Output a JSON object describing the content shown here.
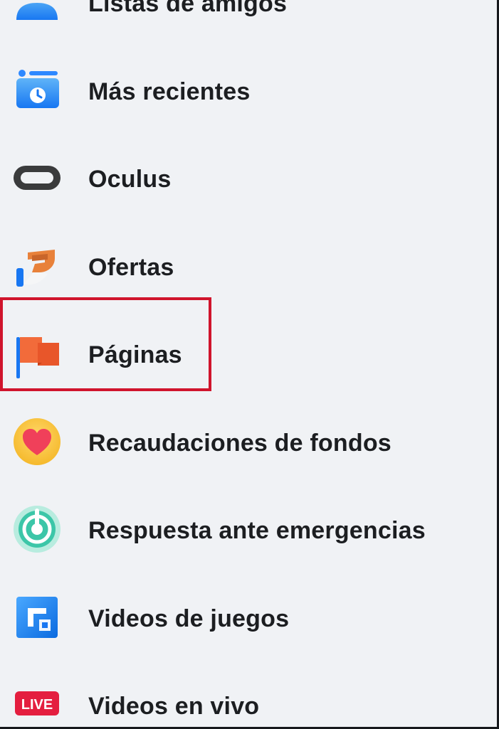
{
  "menu": {
    "items": [
      {
        "label": "Listas de amigos",
        "icon": "friend-lists-icon"
      },
      {
        "label": "Más recientes",
        "icon": "most-recent-icon"
      },
      {
        "label": "Oculus",
        "icon": "oculus-icon"
      },
      {
        "label": "Ofertas",
        "icon": "offers-icon"
      },
      {
        "label": "Páginas",
        "icon": "pages-flag-icon",
        "highlighted": true
      },
      {
        "label": "Recaudaciones de fondos",
        "icon": "fundraisers-icon"
      },
      {
        "label": "Respuesta ante emergencias",
        "icon": "crisis-response-icon"
      },
      {
        "label": "Videos de juegos",
        "icon": "gaming-video-icon"
      },
      {
        "label": "Videos en vivo",
        "icon": "live-video-icon",
        "icon_text": "LIVE"
      }
    ]
  },
  "colors": {
    "background": "#f0f2f5",
    "highlight_border": "#d0142c",
    "text": "#1c1e21"
  }
}
